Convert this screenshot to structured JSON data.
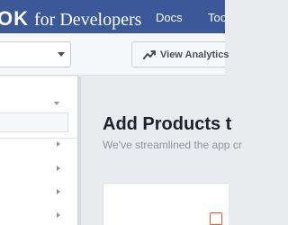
{
  "header": {
    "brand_name": "OK",
    "brand_suffix": "for Developers",
    "nav": {
      "docs": "Docs",
      "tools": "Too"
    }
  },
  "toolbar": {
    "app_select_value": "",
    "view_analytics_label": "View Analytics"
  },
  "main": {
    "title": "Add Products t",
    "subtitle": "We've streamlined the app cr"
  },
  "colors": {
    "brand_blue": "#3b5998",
    "page_background": "#e9ebee",
    "product_icon_accent": "#f25022"
  },
  "icons": [
    "chevron-down-icon",
    "analytics-chart-icon",
    "chevron-right-icon",
    "product-icon"
  ]
}
